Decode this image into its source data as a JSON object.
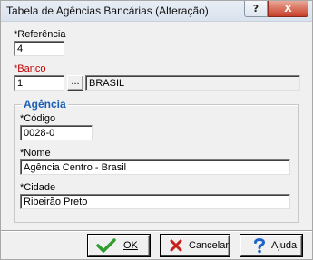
{
  "window": {
    "title": "Tabela de Agências Bancárias (Alteração)",
    "help_glyph": "?",
    "close_glyph": "X"
  },
  "fields": {
    "referencia": {
      "label": "*Referência",
      "value": "4"
    },
    "banco": {
      "label": "*Banco",
      "code": "1",
      "lookup_label": "...",
      "name": "BRASIL"
    }
  },
  "agencia_group": {
    "legend": "Agência",
    "codigo": {
      "label": "*Código",
      "value": "0028-0"
    },
    "nome": {
      "label": "*Nome",
      "value": "Agência Centro - Brasil"
    },
    "cidade": {
      "label": "*Cidade",
      "value": "Ribeirão Preto"
    }
  },
  "buttons": {
    "ok": {
      "label": "OK",
      "icon": "checkmark-icon"
    },
    "cancelar": {
      "label": "Cancelar",
      "icon": "x-icon"
    },
    "ajuda": {
      "label": "Ajuda",
      "icon": "question-icon"
    }
  },
  "colors": {
    "required_red": "#c00000",
    "legend_blue": "#1b5fb5",
    "ok_green": "#2e9e2e",
    "cancel_red": "#c8201a",
    "help_blue": "#1f63c8"
  }
}
